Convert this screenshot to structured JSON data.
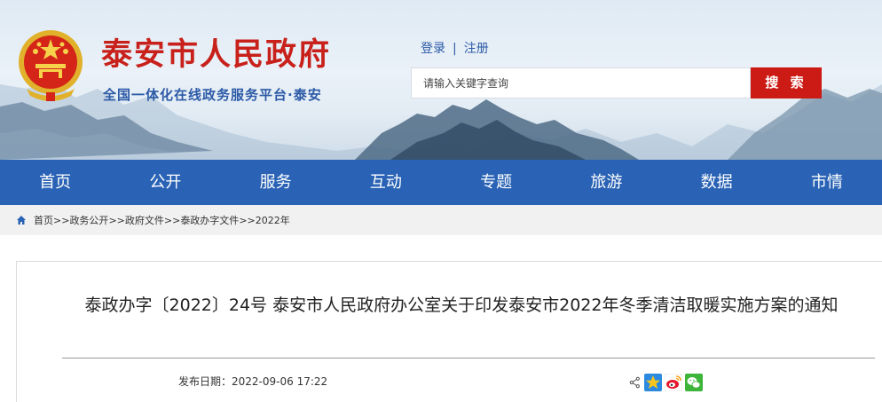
{
  "header": {
    "title": "泰安市人民政府",
    "subtitle": "全国一体化在线政务服务平台·泰安",
    "login": "登录",
    "register": "注册",
    "separator": "|",
    "search_placeholder": "请输入关键字查询",
    "search_button": "搜 索"
  },
  "nav": {
    "items": [
      "首页",
      "公开",
      "服务",
      "互动",
      "专题",
      "旅游",
      "数据",
      "市情"
    ]
  },
  "breadcrumb": {
    "items": [
      "首页",
      "政务公开",
      "政府文件",
      "泰政办字文件",
      "2022年"
    ],
    "separator": ">>"
  },
  "article": {
    "title": "泰政办字〔2022〕24号 泰安市人民政府办公室关于印发泰安市2022年冬季清洁取暖实施方案的通知",
    "date_label": "发布日期：",
    "date": "2022-09-06 17:22"
  },
  "share": {
    "icons": [
      "share-icon",
      "qzone-icon",
      "weibo-icon",
      "wechat-icon"
    ]
  },
  "colors": {
    "nav_bg": "#2a63b5",
    "title_red": "#c8201a",
    "subtitle_blue": "#2c5aa6",
    "search_btn": "#cc1a14"
  }
}
